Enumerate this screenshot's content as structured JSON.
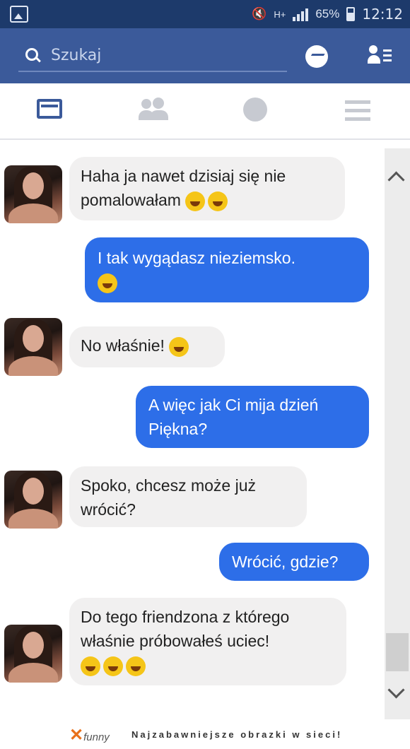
{
  "status_bar": {
    "battery": "65%",
    "time": "12:12",
    "network": "H+"
  },
  "search": {
    "placeholder": "Szukaj"
  },
  "tabs": [
    "feed",
    "friends",
    "globe",
    "menu"
  ],
  "messages": [
    {
      "from": "them",
      "text": "Haha ja nawet dzisiaj się nie pomalowałam",
      "emoji_count": 2
    },
    {
      "from": "me",
      "text": "I tak wygądasz nieziemsko.",
      "emoji_count": 1
    },
    {
      "from": "them",
      "text": "No właśnie!",
      "emoji_count": 1
    },
    {
      "from": "me",
      "text": "A więc jak Ci mija dzień Piękna?",
      "emoji_count": 0
    },
    {
      "from": "them",
      "text": "Spoko, chcesz może już wrócić?",
      "emoji_count": 0
    },
    {
      "from": "me",
      "text": "Wrócić, gdzie?",
      "emoji_count": 0
    },
    {
      "from": "them",
      "text": "Do tego friendzona z którego właśnie próbowałeś uciec!",
      "emoji_count": 3
    }
  ],
  "footer": {
    "logo": "funny",
    "tagline": "Najzabawniejsze obrazki w sieci!"
  },
  "colors": {
    "header": "#3b5a9a",
    "status_bar": "#1d3a6b",
    "outgoing": "#2d6ee8",
    "incoming": "#f1f0f0"
  }
}
